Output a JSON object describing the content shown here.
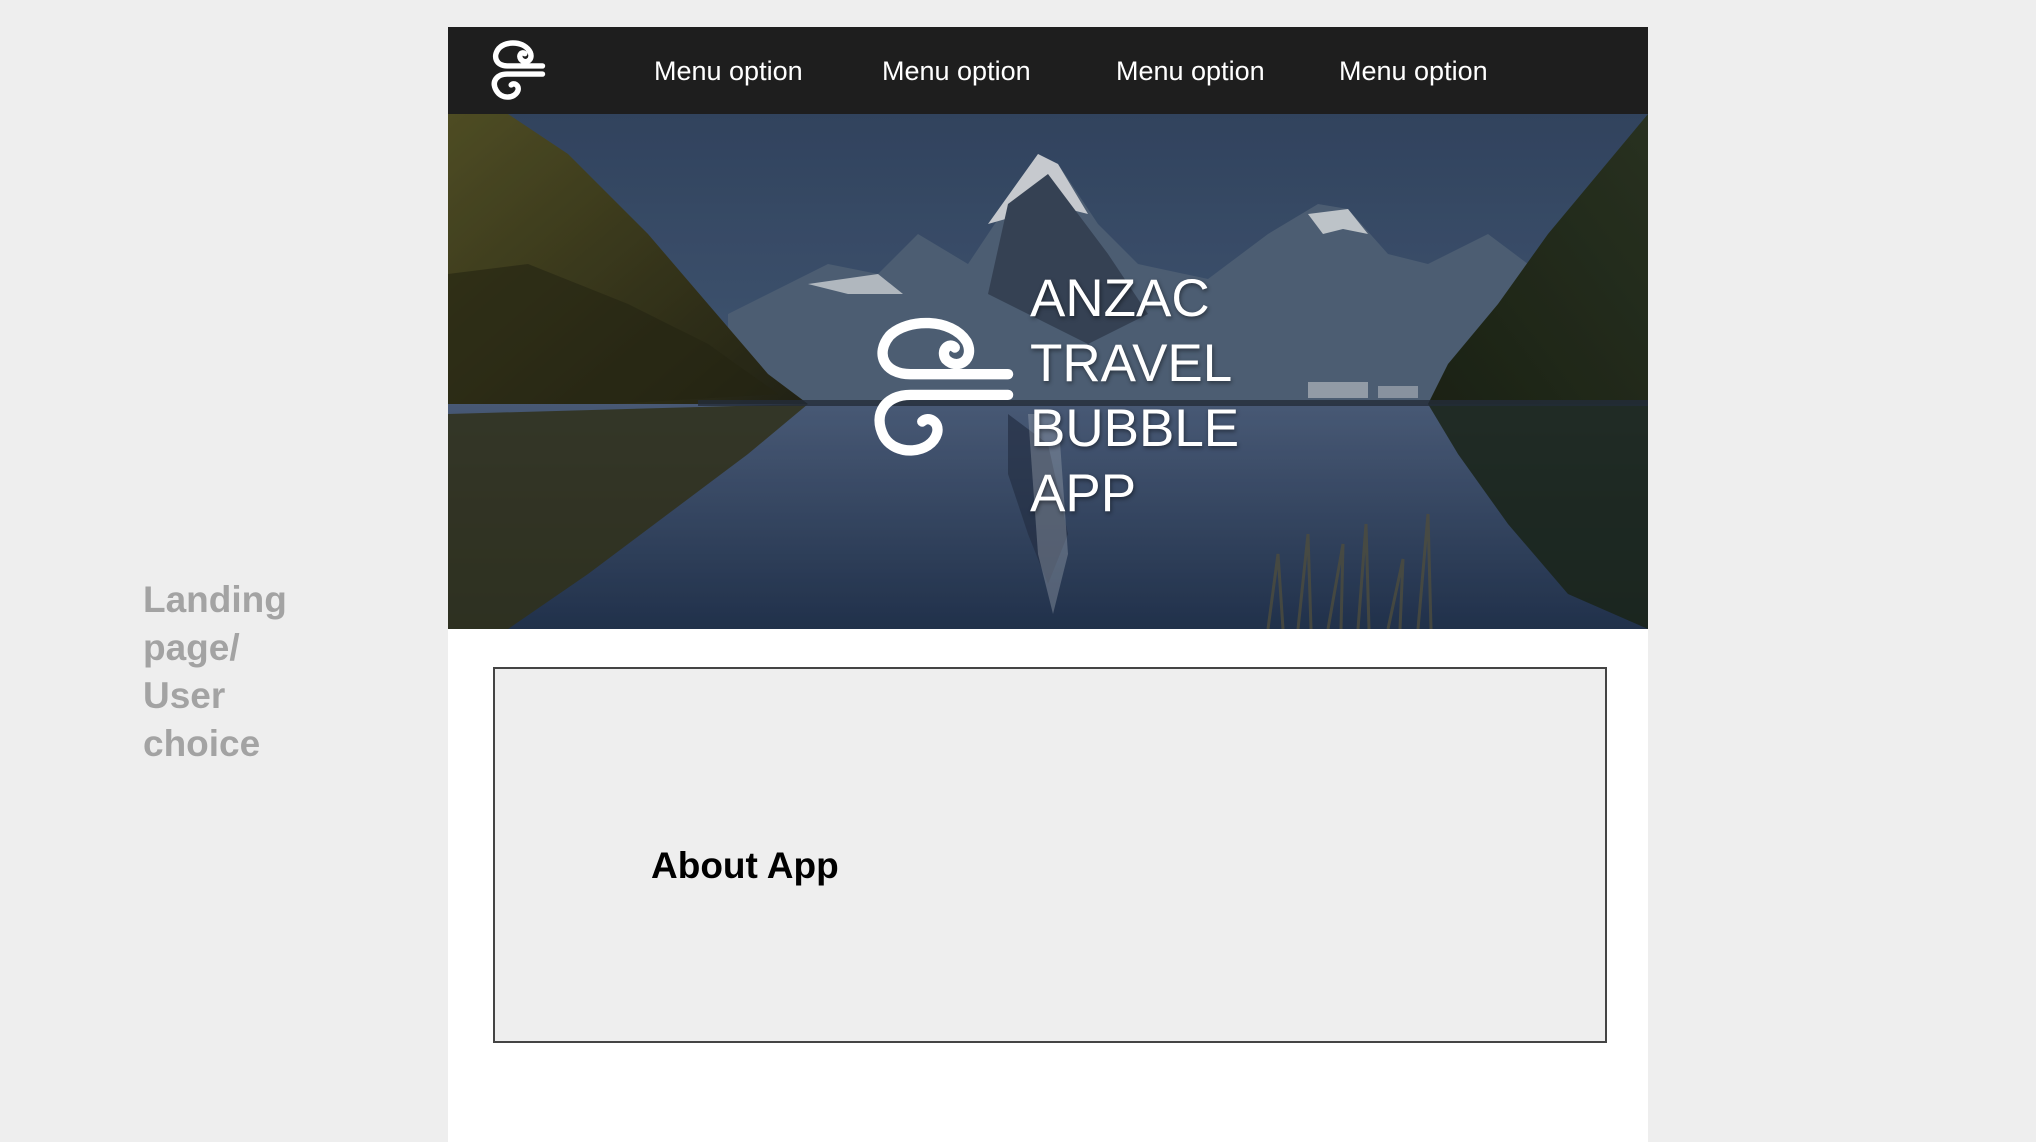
{
  "side_label": "Landing\npage/\nUser\nchoice",
  "nav": {
    "logo_icon": "koru-logo-icon",
    "menu": [
      "Menu option",
      "Menu option",
      "Menu option",
      "Menu option"
    ]
  },
  "hero": {
    "title": "ANZAC\nTRAVEL\nBUBBLE\nAPP",
    "logo_icon": "koru-logo-icon",
    "background": "mountain-lake-landscape"
  },
  "about": {
    "title": "About App"
  },
  "colors": {
    "page_bg": "#eeeeee",
    "nav_bg": "#1e1e1e",
    "nav_text": "#ffffff",
    "side_label": "#a3a3a3",
    "card_border": "#444444"
  }
}
